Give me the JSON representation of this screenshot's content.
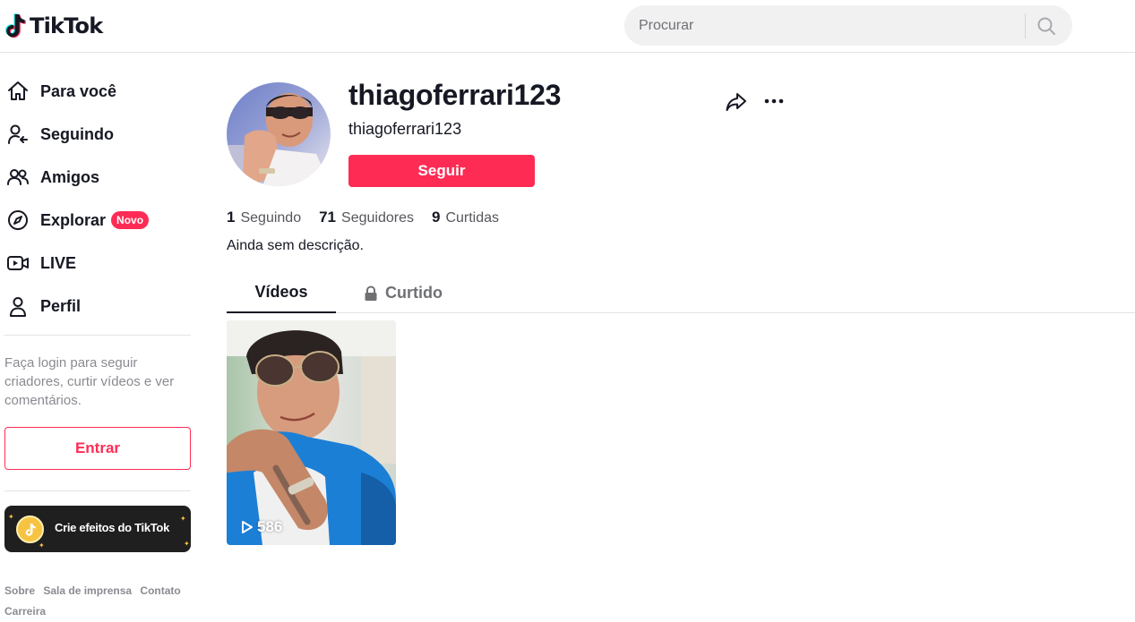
{
  "header": {
    "logo_text": "TikTok",
    "search_placeholder": "Procurar"
  },
  "sidebar": {
    "items": [
      {
        "label": "Para você",
        "icon": "home-icon"
      },
      {
        "label": "Seguindo",
        "icon": "following-icon"
      },
      {
        "label": "Amigos",
        "icon": "friends-icon"
      },
      {
        "label": "Explorar",
        "icon": "compass-icon",
        "badge": "Novo"
      },
      {
        "label": "LIVE",
        "icon": "live-icon"
      },
      {
        "label": "Perfil",
        "icon": "profile-icon"
      }
    ],
    "login_prompt": "Faça login para seguir criadores, curtir vídeos e ver comentários.",
    "login_button": "Entrar",
    "effects_card": "Crie efeitos do TikTok",
    "footer_links": [
      "Sobre",
      "Sala de imprensa",
      "Contato",
      "Carreira"
    ]
  },
  "profile": {
    "name": "thiagoferrari123",
    "handle": "thiagoferrari123",
    "follow_button": "Seguir",
    "stats": [
      {
        "value": "1",
        "label": "Seguindo"
      },
      {
        "value": "71",
        "label": "Seguidores"
      },
      {
        "value": "9",
        "label": "Curtidas"
      }
    ],
    "bio": "Ainda sem descrição."
  },
  "tabs": {
    "videos": "Vídeos",
    "liked": "Curtido"
  },
  "videos": [
    {
      "views": "586"
    }
  ],
  "colors": {
    "brand": "#fe2c55",
    "text": "#161823",
    "muted": "#8a8b91"
  }
}
